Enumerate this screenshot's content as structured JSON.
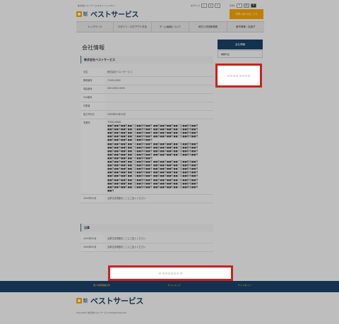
{
  "header": {
    "tagline": "株式会社ベストサービスのオフィシャルサイト",
    "logo_kk": "株式会社",
    "logo_name": "ベストサービス",
    "fontsize_label": "文字サイズ",
    "fontsize_options": [
      "小",
      "中",
      "大"
    ],
    "bgcolor_label": "背景色",
    "bgcolor_options": [
      "白",
      "青",
      "黒"
    ],
    "contact_button": "お問い合わせはこちら"
  },
  "nav": {
    "items": [
      "トップページ",
      "ログイン・ログアウト方法",
      "ホーム画面について",
      "地方公共団体調査",
      "都市情報・拡張子"
    ]
  },
  "main": {
    "page_title": "会社情報",
    "company_heading": "株式会社ベストサービス",
    "rows": [
      {
        "label": "社名",
        "value": "株式会社ベストサービス"
      },
      {
        "label": "郵便番号",
        "value": "〒000-0000"
      },
      {
        "label": "電話番号",
        "value": "000-0000-0000"
      },
      {
        "label": "FAX番号",
        "value": ""
      },
      {
        "label": "代表者",
        "value": ""
      },
      {
        "label": "設立年月日",
        "value": "2000年00月00日"
      }
    ],
    "address_label": "事業所",
    "address_lines": [
      "〒000-0000",
      "■■県■■市■■町■■丁目■■番地■■号 ■■県■■市■■町■■丁目■■番地■■号",
      "■■県■■市■■町■■丁目■■番地■■号 ■■県■■市■■町■■丁目■■番地■■号",
      "■■県■■市■■町■■丁目■■番地■■号 ■■県■■市■■町■■丁目■■番地■■号",
      "■■県■■市■■町■■丁目■■番地■■号 ■■県■■市■■町■■丁目■■番地■■号",
      "■■県■■市■■町■■丁目■■番地■■号",
      "■■県■■市■■町■■丁目■■番地■■号 ■■県■■市■■町■■丁目■■番地■■号",
      "■■県■■市■■町■■丁目■■番地■■号 ■■県■■市■■町■■丁目■■番地■■号",
      "■■県■■市■■町■■丁目■■番地■■号 ■■県■■市■■町■■丁目■■番地■■号",
      "■■県■■市■■町■■丁目■■番地■■号 ■■県■■市■■町■■丁目■■番地■■号",
      "■■県■■市■■町■■丁目■■番地■■号",
      "■■県■■市■■町■■丁目■■番地■■号 ■■県■■市■■町■■丁目■■番地■■号",
      "■■県■■市■■町■■丁目■■番地■■号 ■■県■■市■■町■■丁目■■番地■■号",
      "■■県■■市■■町■■丁目■■番地■■号 ■■県■■市■■町■■丁目■■番地■■号",
      "■■県■■市■■町■■丁目■■番地■■号 ■■県■■市■■町■■丁目■■番地■■号",
      "■■県■■市■■町■■丁目■■番地■■号 ■■県■■市■■町■■丁目■■番地■■号",
      "■■県■■市■■町■■丁目■■番地■■号 ■■県■■市■■町■■丁目■■番地■■号",
      "■■県■■市■■町■■丁目■■番地■■号 ■■県■■市■■町■■丁目■■番地■■号",
      "■■県■■市■■町■■丁目■■番地■■号 ■■県■■市■■町■■丁目■■番地■■号",
      "■■号"
    ],
    "history_row": {
      "label": "2000年00月",
      "value": "沿革文書掲載をここにご記入ください"
    },
    "officer_heading": "沿革",
    "officer_rows": [
      {
        "label": "2000年00月",
        "value": "沿革文書掲載をここにご記入ください"
      },
      {
        "label": "2000年00月",
        "value": "沿革文書掲載をここにご記入ください"
      }
    ]
  },
  "sidebar": {
    "heading": "会社情報",
    "item": "種類代表",
    "item_arrow": "›"
  },
  "footer": {
    "links": [
      "個人情報保護方針",
      "サイトマップ",
      "サイトポリシー"
    ],
    "logo_kk": "株式会社",
    "logo_name": "ベストサービス",
    "copyright": "Copyright© 株式会社ベストサービス All Rights Reserved."
  },
  "colors": {
    "brand_navy": "#1a3f66",
    "accent_orange": "#f5a300",
    "ad_border": "#cc2020"
  }
}
